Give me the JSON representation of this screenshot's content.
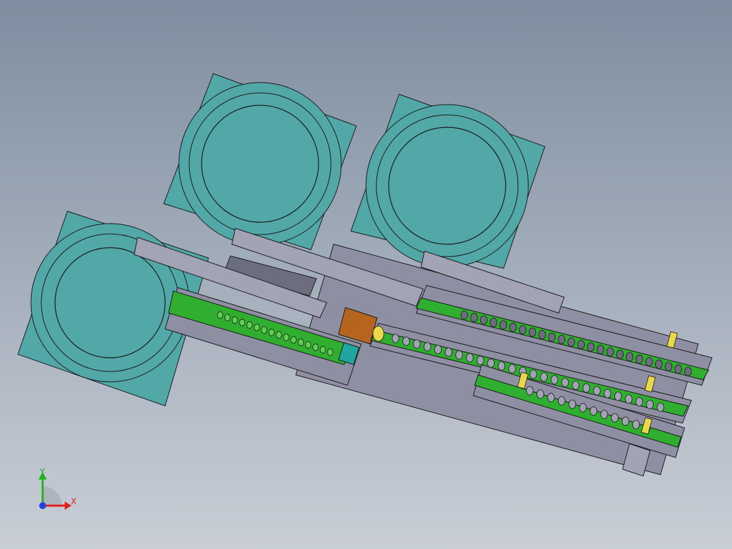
{
  "viewport": {
    "background_top": "#7e8ea0",
    "background_bottom": "#c9ced6"
  },
  "colors": {
    "bowl": "#52a8a6",
    "bowl_dark": "#3f8f8c",
    "rail": "#8f8fa3",
    "rail_dark": "#6d6d80",
    "rail_light": "#a3a3b6",
    "track_green": "#2fae2f",
    "track_green_light": "#5fcf4f",
    "hopper": "#b5651d",
    "sensor": "#1fa69e",
    "marker_yellow": "#e8d84a",
    "outline": "#1a1a1a",
    "axis_x": "#e02020",
    "axis_y": "#20b020",
    "axis_z": "#2040e0"
  },
  "triad": {
    "x_label": "X",
    "y_label": "Y"
  }
}
